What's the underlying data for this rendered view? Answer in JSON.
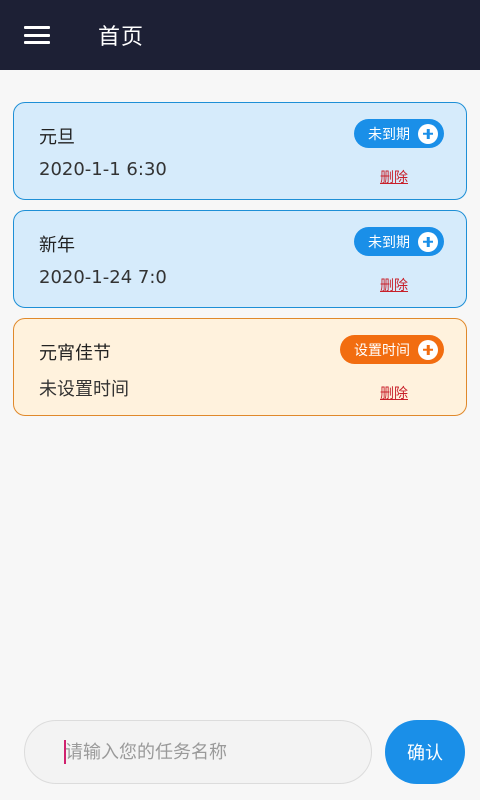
{
  "appbar": {
    "menu_icon": "hamburger-menu-icon",
    "title": "首页",
    "background": "#1d2035"
  },
  "tasks": [
    {
      "name": "元旦",
      "time": "2020-1-1 6:30",
      "status_label": "未到期",
      "delete_label": "删除",
      "status": "due",
      "accent": "#1a8fe8"
    },
    {
      "name": "新年",
      "time": "2020-1-24 7:0",
      "status_label": "未到期",
      "delete_label": "删除",
      "status": "due",
      "accent": "#1a8fe8"
    },
    {
      "name": "元宵佳节",
      "time": "未设置时间",
      "status_label": "设置时间",
      "delete_label": "删除",
      "status": "unset",
      "accent": "#f26d10"
    }
  ],
  "footer": {
    "input_value": "",
    "input_placeholder": "请输入您的任务名称",
    "confirm_label": "确认"
  }
}
